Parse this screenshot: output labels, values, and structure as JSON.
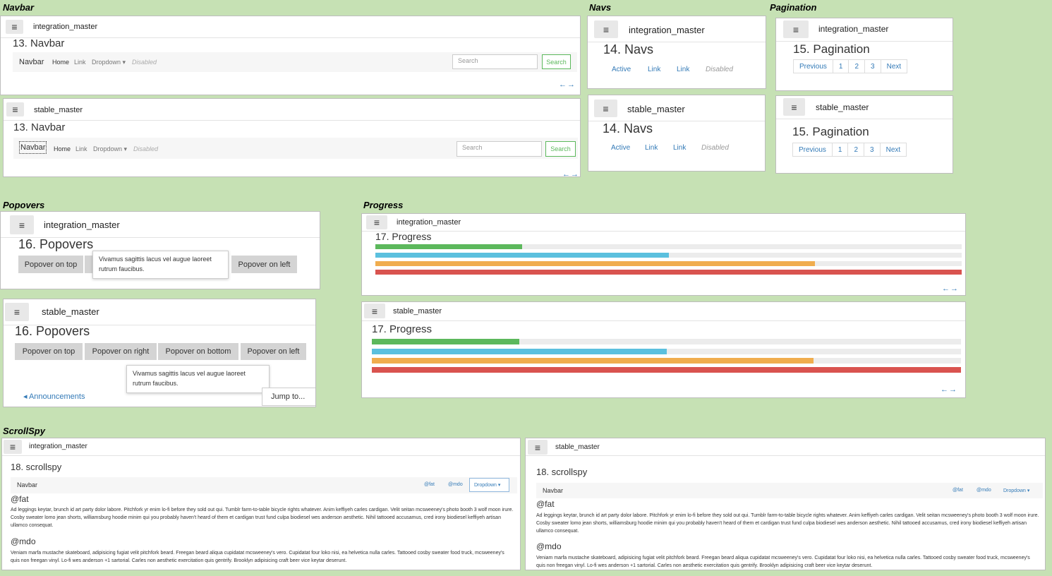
{
  "sections": {
    "navbar": "Navbar",
    "navs": "Navs",
    "pagination": "Pagination",
    "popovers": "Popovers",
    "progress": "Progress",
    "scrollspy": "ScrollSpy"
  },
  "branches": {
    "integration": "integration_master",
    "stable": "stable_master"
  },
  "menu_glyph": "≡",
  "arrows": "←→",
  "navbar": {
    "title": "13. Navbar",
    "brand": "Navbar",
    "home": "Home",
    "link": "Link",
    "dropdown": "Dropdown ▾",
    "disabled": "Disabled",
    "search_placeholder": "Search",
    "search_button": "Search"
  },
  "navs": {
    "title": "14. Navs",
    "active": "Active",
    "link1": "Link",
    "link2": "Link",
    "disabled": "Disabled"
  },
  "pagination": {
    "title": "15. Pagination",
    "items": [
      "Previous",
      "1",
      "2",
      "3",
      "Next"
    ]
  },
  "popovers": {
    "title": "16. Popovers",
    "top": "Popover on top",
    "right": "Popover on right",
    "bottom": "Popover on bottom",
    "left": "Popover on left",
    "tip": "Vivamus sagittis lacus vel augue laoreet rutrum faucibus.",
    "announcements": "◂ Announcements",
    "jump": "Jump to..."
  },
  "progress": {
    "title": "17. Progress",
    "bars": [
      {
        "value": 25,
        "color": "#5cb85c"
      },
      {
        "value": 50,
        "color": "#5bc0de"
      },
      {
        "value": 75,
        "color": "#f0ad4e"
      },
      {
        "value": 100,
        "color": "#d9534f"
      }
    ]
  },
  "scrollspy": {
    "title": "18. scrollspy",
    "brand": "Navbar",
    "fat_link": "@fat",
    "mdo_link": "@mdo",
    "dropdown": "Dropdown ▾",
    "fat": "@fat",
    "fat_text": "Ad leggings keytar, brunch id art party dolor labore. Pitchfork yr enim lo-fi before they sold out qui. Tumblr farm-to-table bicycle rights whatever. Anim keffiyeh carles cardigan. Velit seitan mcsweeney's photo booth 3 wolf moon irure. Cosby sweater lomo jean shorts, williamsburg hoodie minim qui you probably haven't heard of them et cardigan trust fund culpa biodiesel wes anderson aesthetic. Nihil tattooed accusamus, cred irony biodiesel keffiyeh artisan ullamco consequat.",
    "mdo": "@mdo",
    "mdo_text": "Veniam marfa mustache skateboard, adipisicing fugiat velit pitchfork beard. Freegan beard aliqua cupidatat mcsweeney's vero. Cupidatat four loko nisi, ea helvetica nulla carles. Tattooed cosby sweater food truck, mcsweeney's quis non freegan vinyl. Lo-fi wes anderson +1 sartorial. Carles non aesthetic exercitation quis gentrify. Brooklyn adipisicing craft beer vice keytar deserunt."
  }
}
